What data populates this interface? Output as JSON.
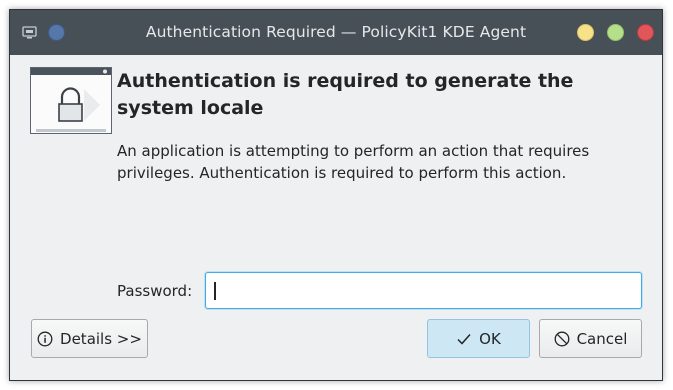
{
  "window": {
    "title": "Authentication Required — PolicyKit1 KDE Agent"
  },
  "titlebar_controls": {
    "left": [
      "app-menu-icon",
      "keep-on-all-desktops-icon"
    ],
    "right": [
      "minimize-icon",
      "maximize-icon",
      "close-icon"
    ],
    "colors": {
      "on_all_desktops": "#5577aa",
      "minimize": "#f7e189",
      "maximize": "#b6df8b",
      "close": "#e0565b"
    }
  },
  "dialog": {
    "heading": "Authentication is required to generate the system locale",
    "description": "An application is attempting to perform an action that requires privileges. Authentication is required to perform this action."
  },
  "password": {
    "label": "Password:",
    "value": "",
    "focused": true
  },
  "buttons": {
    "details": {
      "icon": "info-icon",
      "label": "Details >>"
    },
    "ok": {
      "icon": "checkmark-icon",
      "label": "OK"
    },
    "cancel": {
      "icon": "cancel-icon",
      "label": "Cancel"
    }
  },
  "colors": {
    "titlebar": "#475057",
    "window_bg": "#eff0f1",
    "focus_accent": "#3daee9",
    "default_button_bg": "#cde7f4"
  }
}
